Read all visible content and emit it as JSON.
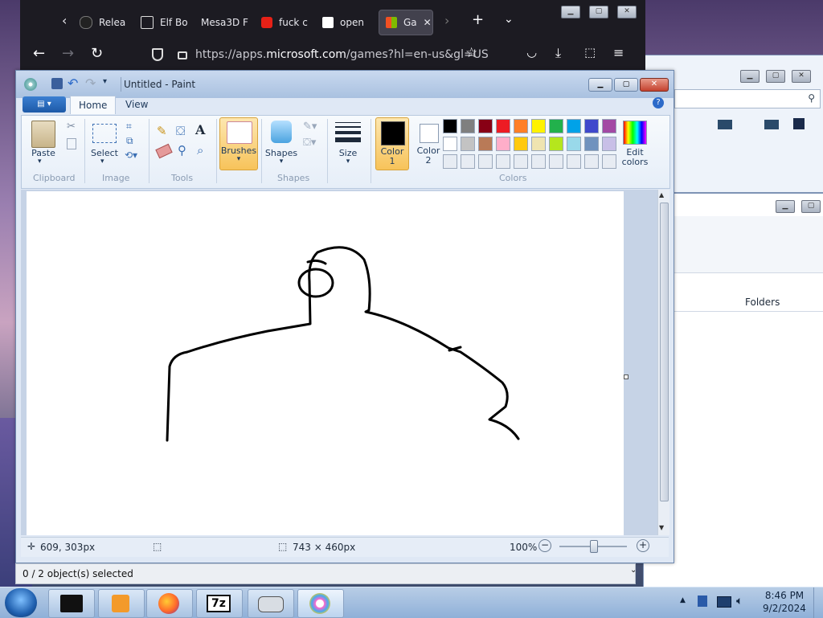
{
  "browser": {
    "tabs": [
      {
        "label": "Relea"
      },
      {
        "label": "Elf Bo"
      },
      {
        "label": "Mesa3D F"
      },
      {
        "label": "fuck c"
      },
      {
        "label": "open"
      },
      {
        "label": "Ga"
      }
    ],
    "url_prefix": "https://apps.",
    "url_domain": "microsoft.com",
    "url_suffix": "/games?hl=en-us&gl=US"
  },
  "paint": {
    "title": "Untitled - Paint",
    "tabs": {
      "home": "Home",
      "view": "View"
    },
    "clipboard": {
      "paste": "Paste",
      "group": "Clipboard"
    },
    "image": {
      "select": "Select",
      "group": "Image"
    },
    "tools": {
      "group": "Tools",
      "text_glyph": "A"
    },
    "brushes": "Brushes",
    "shapes": {
      "label": "Shapes",
      "group": "Shapes"
    },
    "size": "Size",
    "color1": {
      "line1": "Color",
      "line2": "1"
    },
    "color2": {
      "line1": "Color",
      "line2": "2"
    },
    "edit_colors": {
      "line1": "Edit",
      "line2": "colors"
    },
    "colors_group": "Colors",
    "palette_row1": [
      "#000000",
      "#7f7f7f",
      "#880015",
      "#ed1c24",
      "#ff7f27",
      "#fff200",
      "#22b14c",
      "#00a2e8",
      "#3f48cc",
      "#a349a4"
    ],
    "palette_row2": [
      "#ffffff",
      "#c3c3c3",
      "#b97a57",
      "#ffaec9",
      "#ffc90e",
      "#efe4b0",
      "#b5e61d",
      "#99d9ea",
      "#7092be",
      "#c8bfe7"
    ],
    "status": {
      "cursor": "609, 303px",
      "dimensions": "743 × 460px",
      "zoom": "100%",
      "zoom_level": 0.5
    },
    "selection": "0 / 2 object(s) selected"
  },
  "explorer": {
    "folders": "Folders"
  },
  "taskbar": {
    "time": "8:46 PM",
    "date": "9/2/2024",
    "sevenzip": "7z"
  },
  "colors": {
    "accent_active": "#fbd380",
    "browser_bg": "#1c1b22"
  }
}
